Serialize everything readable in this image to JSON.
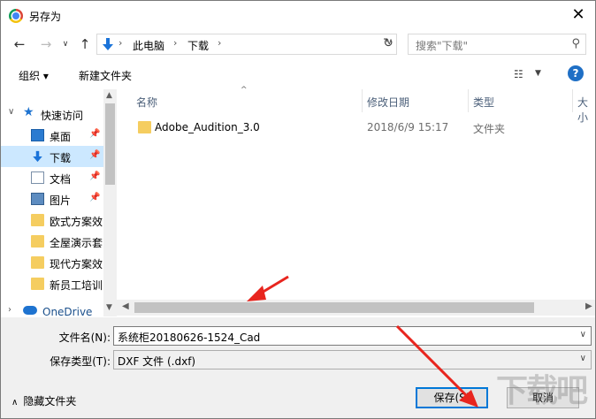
{
  "window": {
    "title": "另存为",
    "close_glyph": "✕"
  },
  "nav": {
    "back": "←",
    "forward": "→",
    "up": "↑",
    "dropdown": "∨",
    "refresh": "↻",
    "breadcrumb": [
      "此电脑",
      "下载"
    ],
    "search_placeholder": "搜索\"下载\""
  },
  "toolbar": {
    "organize": "组织 ▾",
    "new_folder": "新建文件夹",
    "help": "?"
  },
  "sidebar": {
    "quick_access": "快速访问",
    "items": [
      {
        "label": "桌面",
        "icon": "desktop-icon",
        "pinned": true
      },
      {
        "label": "下载",
        "icon": "download-icon",
        "pinned": true,
        "selected": true
      },
      {
        "label": "文档",
        "icon": "document-icon",
        "pinned": true
      },
      {
        "label": "图片",
        "icon": "picture-icon",
        "pinned": true
      },
      {
        "label": "欧式方案效",
        "icon": "folder-icon"
      },
      {
        "label": "全屋演示套",
        "icon": "folder-icon"
      },
      {
        "label": "现代方案效",
        "icon": "folder-icon"
      },
      {
        "label": "新员工培训",
        "icon": "folder-icon"
      }
    ],
    "onedrive": "OneDrive"
  },
  "filelist": {
    "columns": [
      "名称",
      "修改日期",
      "类型",
      "大小"
    ],
    "rows": [
      {
        "name": "Adobe_Audition_3.0",
        "date": "2018/6/9 15:17",
        "type": "文件夹"
      }
    ]
  },
  "form": {
    "filename_label": "文件名(N):",
    "filename_value": "系统柜20180626-1524_Cad",
    "filetype_label": "保存类型(T):",
    "filetype_value": "DXF 文件 (.dxf)"
  },
  "footer": {
    "hide_folders": "隐藏文件夹",
    "save": "保存(S)",
    "cancel": "取消"
  },
  "colors": {
    "accent": "#0078d7",
    "selected_bg": "#cce8ff",
    "annotation": "#e8251e"
  }
}
